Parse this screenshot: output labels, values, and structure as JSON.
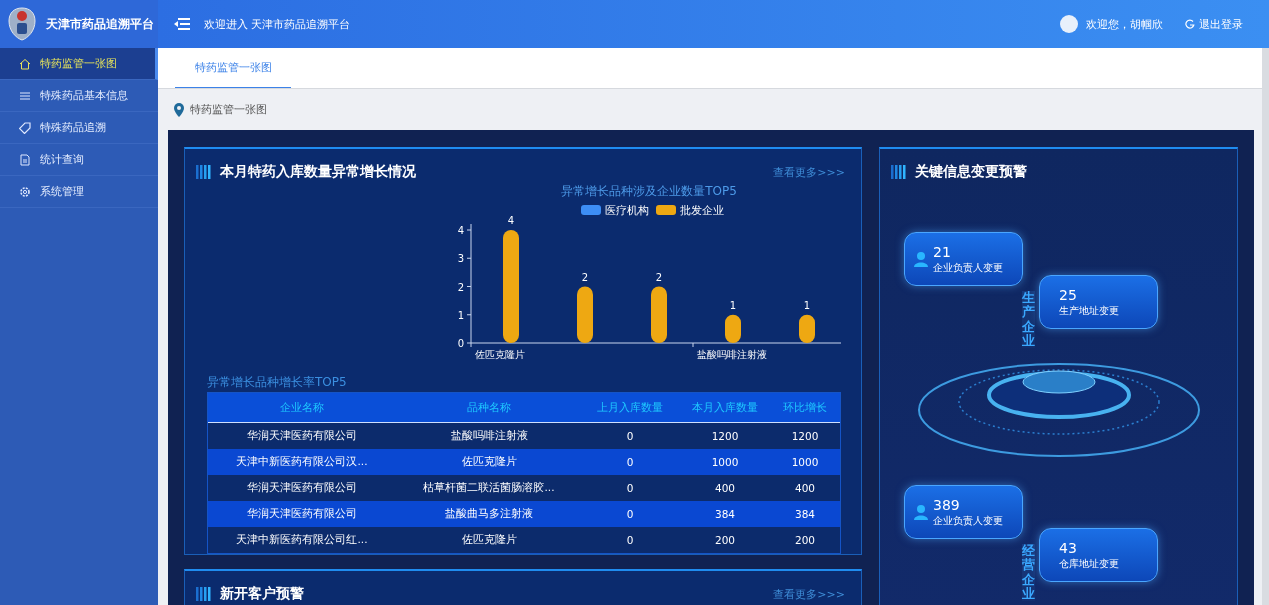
{
  "header": {
    "logo_title": "天津市药品追溯平台",
    "welcome": "欢迎进入 天津市药品追溯平台",
    "user_greeting": "欢迎您，胡帼欣",
    "logout": "退出登录"
  },
  "sidebar": {
    "items": [
      {
        "label": "特药监管一张图",
        "kind": "home",
        "selected": true
      },
      {
        "label": "特殊药品基本信息",
        "kind": "list",
        "selected": false
      },
      {
        "label": "特殊药品追溯",
        "kind": "tag",
        "selected": false
      },
      {
        "label": "统计查询",
        "kind": "document",
        "selected": false
      },
      {
        "label": "系统管理",
        "kind": "gear",
        "selected": false
      }
    ]
  },
  "tabs": [
    {
      "label": "特药监管一张图",
      "selected": true
    }
  ],
  "breadcrumb": "特药监管一张图",
  "growth_panel": {
    "title": "本月特药入库数量异常增长情况",
    "more": "查看更多>>>",
    "chart_data": {
      "type": "bar",
      "title": "异常增长品种涉及企业数量TOP5",
      "categories": [
        "佐匹克隆片",
        null,
        null,
        "盐酸吗啡注射液",
        null
      ],
      "series": [
        {
          "name": "医疗机构",
          "color": "#3d8ef5",
          "values": [
            null,
            null,
            null,
            null,
            null
          ]
        },
        {
          "name": "批发企业",
          "color": "#eea812",
          "values": [
            4,
            2,
            2,
            1,
            1
          ]
        }
      ],
      "ylim": [
        0,
        4
      ],
      "yticks": [
        0,
        1,
        2,
        3,
        4
      ],
      "data_labels": true
    },
    "table_title": "异常增长品种增长率TOP5",
    "table": {
      "columns": [
        "企业名称",
        "品种名称",
        "上月入库数量",
        "本月入库数量",
        "环比增长"
      ],
      "rows": [
        [
          "华润天津医药有限公司",
          "盐酸吗啡注射液",
          "0",
          "1200",
          "1200"
        ],
        [
          "天津中新医药有限公司汉...",
          "佐匹克隆片",
          "0",
          "1000",
          "1000"
        ],
        [
          "华润天津医药有限公司",
          "枯草杆菌二联活菌肠溶胶...",
          "0",
          "400",
          "400"
        ],
        [
          "华润天津医药有限公司",
          "盐酸曲马多注射液",
          "0",
          "384",
          "384"
        ],
        [
          "天津中新医药有限公司红...",
          "佐匹克隆片",
          "0",
          "200",
          "200"
        ]
      ]
    }
  },
  "change_panel": {
    "title": "关键信息变更预警",
    "groups": [
      {
        "pillar_label": "生产企业",
        "cards": [
          {
            "value": "21",
            "label": "企业负责人变更",
            "kind": "person"
          },
          {
            "value": "25",
            "label": "生产地址变更",
            "kind": "plain"
          }
        ]
      },
      {
        "pillar_label": "经营企业",
        "cards": [
          {
            "value": "389",
            "label": "企业负责人变更",
            "kind": "person"
          },
          {
            "value": "43",
            "label": "仓库地址变更",
            "kind": "plain"
          }
        ]
      }
    ]
  },
  "customer_panel": {
    "title": "新开客户预警",
    "more": "查看更多>>>"
  }
}
